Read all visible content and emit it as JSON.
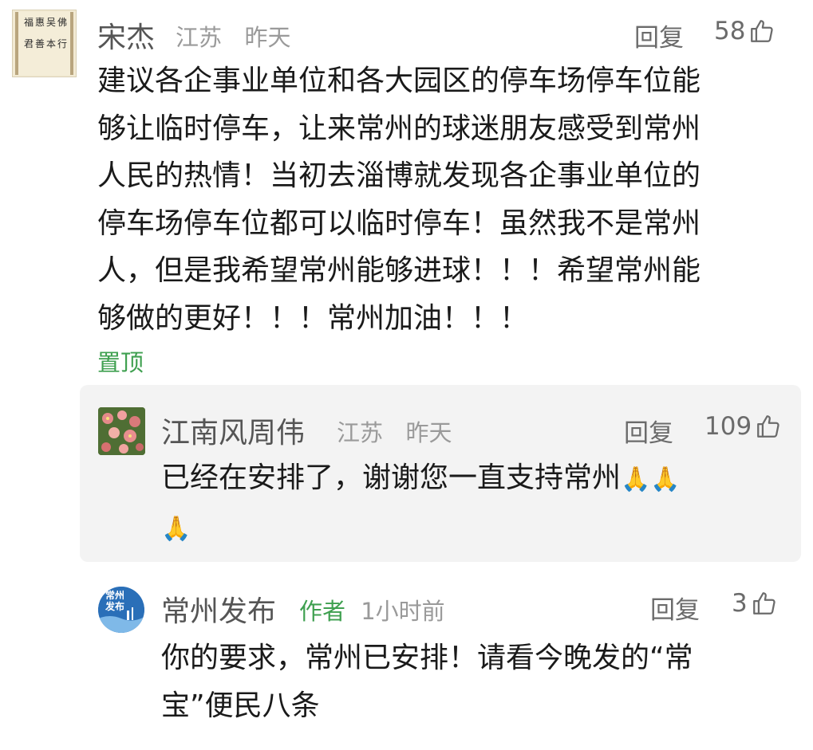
{
  "comments": [
    {
      "name": "宋杰",
      "location": "江苏",
      "time": "昨天",
      "reply_label": "回复",
      "likes": "58",
      "lines": [
        "建议各企事业单位和各大园区的停车场停车位能",
        "够让临时停车，让来常州的球迷朋友感受到常州",
        "人民的热情！当初去淄博就发现各企事业单位的",
        "停车场停车位都可以临时停车！虽然我不是常州",
        "人，但是我希望常州能够进球！！！希望常州能",
        "够做的更好！！！常州加油！！！"
      ],
      "pin_label": "置顶",
      "avatar_icon": "calligraphy-scroll-icon",
      "avatar_text": [
        "福",
        "惠",
        "吴",
        "佛",
        "君",
        "善",
        "本",
        "行"
      ]
    },
    {
      "name": "江南风周伟",
      "location": "江苏",
      "time": "昨天",
      "reply_label": "回复",
      "likes": "109",
      "lines": [
        "已经在安排了，谢谢您一直支持常州"
      ],
      "emoji_icon": "praying-hands-emoji",
      "avatar_icon": "flower-photo-icon"
    },
    {
      "name": "常州发布",
      "badge": "作者",
      "time": "1小时前",
      "reply_label": "回复",
      "likes": "3",
      "lines": [
        "你的要求，常州已安排！请看今晚发的“常",
        "宝”便民八条"
      ],
      "avatar_icon": "changzhou-fabu-logo",
      "avatar_text": [
        "常州",
        "发布"
      ]
    }
  ],
  "colors": {
    "accent_green": "#3fa050",
    "name_gray": "#555555",
    "meta_gray": "#9a9a9a",
    "reply_bg": "#f3f3f3",
    "logo_blue": "#2a6fb8"
  }
}
